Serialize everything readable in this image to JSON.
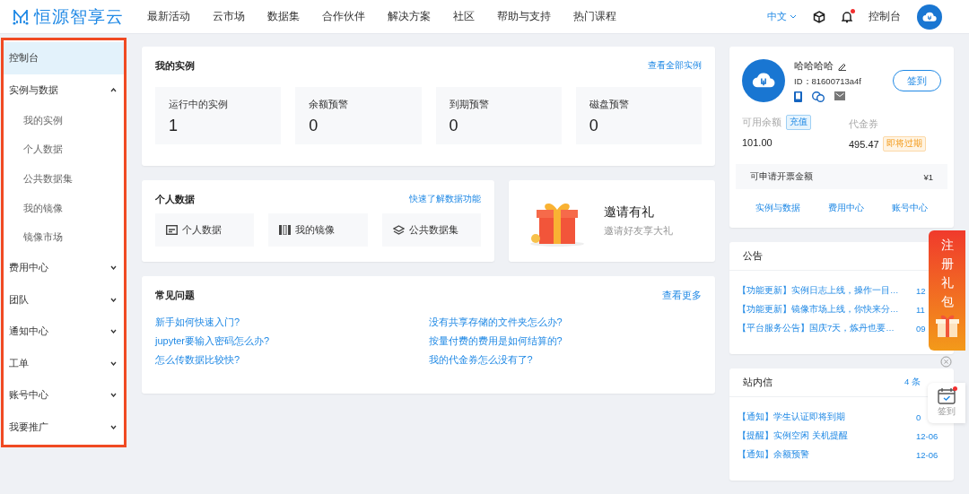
{
  "header": {
    "logo_text": "恒源智享云",
    "nav": [
      "最新活动",
      "云市场",
      "数据集",
      "合作伙伴",
      "解决方案",
      "社区",
      "帮助与支持",
      "热门课程"
    ],
    "language": "中文",
    "notification_unread": true,
    "console_link": "控制台"
  },
  "sidebar": {
    "outlined": true,
    "items": [
      {
        "label": "控制台",
        "selected": true,
        "expanded": false
      },
      {
        "label": "实例与数据",
        "selected": false,
        "expanded": true,
        "children": [
          {
            "label": "我的实例"
          },
          {
            "label": "个人数据"
          },
          {
            "label": "公共数据集"
          },
          {
            "label": "我的镜像"
          },
          {
            "label": "镜像市场"
          }
        ]
      },
      {
        "label": "费用中心",
        "selected": false,
        "expanded": false
      },
      {
        "label": "团队",
        "selected": false,
        "expanded": false
      },
      {
        "label": "通知中心",
        "selected": false,
        "expanded": false
      },
      {
        "label": "工单",
        "selected": false,
        "expanded": false
      },
      {
        "label": "账号中心",
        "selected": false,
        "expanded": false
      },
      {
        "label": "我要推广",
        "selected": false,
        "expanded": false
      }
    ]
  },
  "instances": {
    "title": "我的实例",
    "link": "查看全部实例",
    "stats": [
      {
        "label": "运行中的实例",
        "value": "1"
      },
      {
        "label": "余额预警",
        "value": "0"
      },
      {
        "label": "到期预警",
        "value": "0"
      },
      {
        "label": "磁盘预警",
        "value": "0"
      }
    ]
  },
  "personal_data": {
    "title": "个人数据",
    "link": "快速了解数据功能",
    "items": [
      {
        "kind": "data",
        "label": "个人数据"
      },
      {
        "kind": "image",
        "label": "我的镜像"
      },
      {
        "kind": "dataset",
        "label": "公共数据集"
      }
    ]
  },
  "invite": {
    "title": "邀请有礼",
    "subtitle": "邀请好友享大礼"
  },
  "faq": {
    "title": "常见问题",
    "link": "查看更多",
    "questions": [
      "新手如何快速入门?",
      "没有共享存储的文件夹怎么办?",
      "jupyter要输入密码怎么办?",
      "按量付费的费用是如何结算的?",
      "怎么传数据比较快?",
      "我的代金券怎么没有了?"
    ]
  },
  "profile": {
    "name": "哈哈哈哈",
    "id": "ID：81600713a4f",
    "sign_in": "签到",
    "balance_label": "可用余额",
    "recharge": "充值",
    "balance": "101.00",
    "voucher_label": "代金券",
    "voucher": "495.47",
    "voucher_badge": "即将过期",
    "invoice_label": "可申请开票金额",
    "invoice_amount": "¥1",
    "links": [
      "实例与数据",
      "费用中心",
      "账号中心"
    ]
  },
  "announcements": {
    "title": "公告",
    "items": [
      {
        "text": "【功能更新】实例日志上线，操作一目…",
        "date": "12"
      },
      {
        "text": "【功能更新】镜像市场上线，你快来分…",
        "date": "11"
      },
      {
        "text": "【平台服务公告】国庆7天，炼丹也要…",
        "date": "09"
      }
    ]
  },
  "messages": {
    "title": "站内信",
    "count": "4 条",
    "items": [
      {
        "text": "【通知】学生认证即将到期",
        "date": "0"
      },
      {
        "text": "【提醒】实例空闲 关机提醒",
        "date": "12-06"
      },
      {
        "text": "【通知】余额预警",
        "date": "12-06"
      }
    ]
  },
  "register_gift": {
    "text": "注册礼包"
  },
  "sign_widget": {
    "label": "签到",
    "unread": true
  }
}
